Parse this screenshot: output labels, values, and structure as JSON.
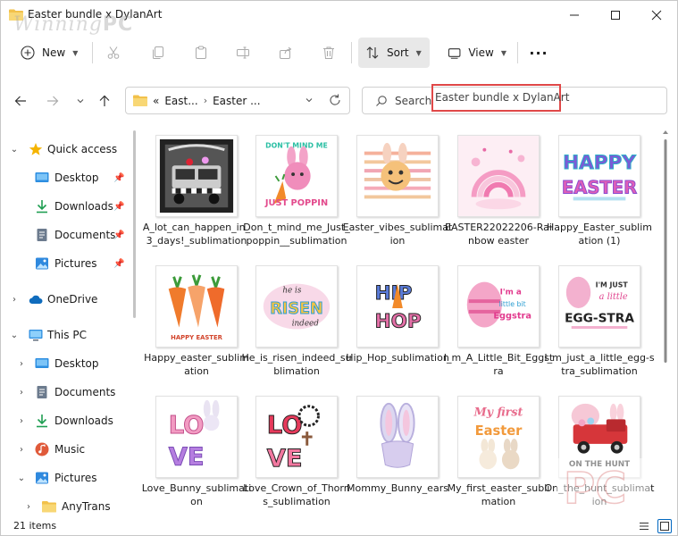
{
  "window": {
    "title": "Easter bundle x DylanArt",
    "watermark_text": "Winning",
    "watermark_bold": "PC"
  },
  "toolbar": {
    "new_label": "New",
    "sort_label": "Sort",
    "view_label": "View",
    "more_label": "···"
  },
  "address": {
    "overflow": "«",
    "crumbs": [
      "East...",
      "Easter ..."
    ]
  },
  "search": {
    "prefix": "Search",
    "query": "Easter bundle x DylanArt"
  },
  "sidebar": {
    "items": [
      {
        "label": "Quick access",
        "icon": "star-icon",
        "pinned": false
      },
      {
        "label": "Desktop",
        "icon": "desktop-icon",
        "pinned": true
      },
      {
        "label": "Downloads",
        "icon": "download-icon",
        "pinned": true
      },
      {
        "label": "Documents",
        "icon": "documents-icon",
        "pinned": true
      },
      {
        "label": "Pictures",
        "icon": "pictures-icon",
        "pinned": true
      },
      {
        "label": "OneDrive",
        "icon": "cloud-icon",
        "pinned": false
      },
      {
        "label": "This PC",
        "icon": "computer-icon",
        "pinned": false
      },
      {
        "label": "Desktop",
        "icon": "desktop-icon",
        "pinned": false
      },
      {
        "label": "Documents",
        "icon": "documents-icon",
        "pinned": false
      },
      {
        "label": "Downloads",
        "icon": "download-icon",
        "pinned": false
      },
      {
        "label": "Music",
        "icon": "music-icon",
        "pinned": false
      },
      {
        "label": "Pictures",
        "icon": "pictures-icon",
        "pinned": false
      },
      {
        "label": "AnyTrans",
        "icon": "folder-icon",
        "pinned": false
      }
    ]
  },
  "files": [
    {
      "name": "A_lot_can_happen_in_3_days!_sublimation",
      "art": "truck-bw-thumbnail"
    },
    {
      "name": "Don_t_mind_me_Just_poppin__sublimation",
      "art": "bunny-carrot-thumbnail",
      "text1": "DON'T MIND ME",
      "text2": "JUST POPPIN"
    },
    {
      "name": "Easter_vibes_sublimation",
      "art": "smiley-bunny-thumbnail"
    },
    {
      "name": "EASTER22022206-Rainbow easter",
      "art": "rainbow-thumbnail"
    },
    {
      "name": "Happy_Easter_sublimation (1)",
      "art": "happy-easter-thumbnail",
      "text1": "HAPPY",
      "text2": "EASTER"
    },
    {
      "name": "Happy_easter_sublimation",
      "art": "carrots-thumbnail",
      "text1": "HAPPY EASTER"
    },
    {
      "name": "He_is_risen_indeed_sublimation",
      "art": "risen-thumbnail",
      "text1": "he is",
      "text2": "RISEN",
      "text3": "indeed"
    },
    {
      "name": "Hip_Hop_sublimation",
      "art": "hip-hop-thumbnail",
      "text1": "HIP",
      "text2": "HOP"
    },
    {
      "name": "I_m_A_Little_Bit_Eggstra",
      "art": "eggstra-bit-thumbnail",
      "text1": "I'm a",
      "text2": "little bit",
      "text3": "Eggstra"
    },
    {
      "name": "I_m_just_a_little_egg-stra_sublimation",
      "art": "egg-stra-thumbnail",
      "text1": "I'M JUST",
      "text2": "a little",
      "text3": "EGG-STRA"
    },
    {
      "name": "Love_Bunny_sublimation",
      "art": "love-bunny-thumbnail",
      "text1": "LO",
      "text2": "VE"
    },
    {
      "name": "Love_Crown_of_Thorns_sublimation",
      "art": "love-crown-thumbnail",
      "text1": "LO",
      "text2": "VE"
    },
    {
      "name": "Mommy_Bunny_ears",
      "art": "mommy-bunny-thumbnail"
    },
    {
      "name": "My_first_easter_sublimation",
      "art": "first-easter-thumbnail",
      "text1": "My first",
      "text2": "Easter"
    },
    {
      "name": "On_the_hunt_sublimation",
      "art": "on-the-hunt-thumbnail",
      "text1": "ON THE HUNT"
    }
  ],
  "status": {
    "count": "21 items"
  },
  "colors": {
    "accent": "#0067c0",
    "folder": "#f2c14b",
    "highlight_border": "#e04848"
  }
}
